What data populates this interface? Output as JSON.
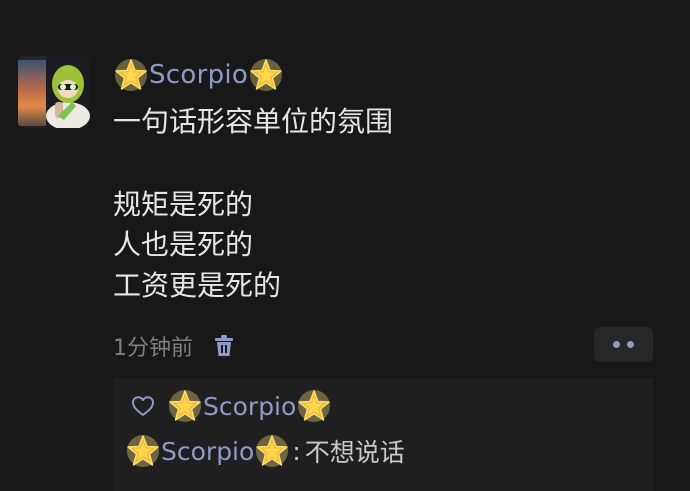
{
  "post": {
    "author": "Scorpio",
    "title_line": "一句话形容单位的氛围",
    "body_lines": [
      "规矩是死的",
      "人也是死的",
      "工资更是死的"
    ],
    "time": "1分钟前"
  },
  "icons": {
    "avatar": "avatar-photo",
    "name_decoration": "glowing-star-emoji",
    "delete": "trash-icon",
    "more": "more-dots-icon",
    "like": "heart-outline-icon"
  },
  "likes": {
    "users": [
      "Scorpio"
    ]
  },
  "comments": [
    {
      "author": "Scorpio",
      "separator": ":",
      "text": "不想说话"
    }
  ],
  "colors": {
    "background": "#181818",
    "name": "#8f9bc6",
    "text": "#e6e6e6",
    "meta": "#7f7f7f",
    "panel": "#1f1f1f"
  }
}
